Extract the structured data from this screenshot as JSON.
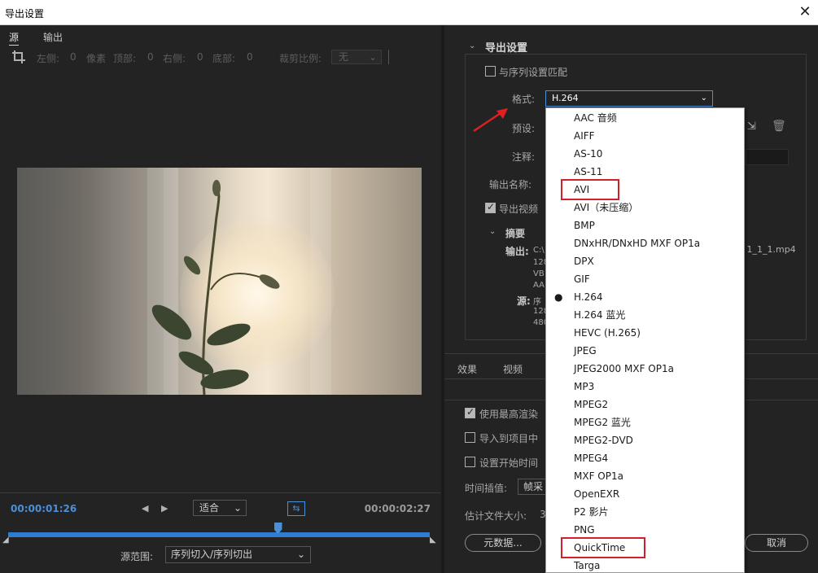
{
  "window": {
    "title": "导出设置",
    "close": "✕"
  },
  "left": {
    "tabs": [
      {
        "label": "源"
      },
      {
        "label": "输出"
      }
    ],
    "crop": {
      "left_label": "左侧:",
      "left_val": "0",
      "px_label": "像素",
      "top_label": "顶部:",
      "top_val": "0",
      "right_label": "右侧:",
      "right_val": "0",
      "bottom_label": "底部:",
      "bottom_val": "0",
      "ratio_label": "裁剪比例:",
      "ratio_val": "无"
    },
    "timeline": {
      "current": "00:00:01:26",
      "duration": "00:00:02:27",
      "fit": "适合",
      "range_label": "源范围:",
      "range_value": "序列切入/序列切出",
      "playhead_fraction": 0.64
    }
  },
  "right": {
    "section_title": "导出设置",
    "match_sequence": "与序列设置匹配",
    "format_label": "格式:",
    "format_value": "H.264",
    "preset_label": "预设:",
    "comment_label": "注释:",
    "output_name_label": "输出名称:",
    "export_video": "导出视频",
    "summary_label": "摘要",
    "summary_output": "输出:",
    "summary_output_lines": [
      "C:\\",
      "128",
      "VB",
      "AA"
    ],
    "summary_source": "源:",
    "summary_source_lines": [
      "序",
      "128",
      "480"
    ],
    "filename_tail": " 1_1_1.mp4",
    "tabs": [
      {
        "label": "效果"
      },
      {
        "label": "视频"
      }
    ],
    "max_render": "使用最高渲染",
    "import_project": "导入到项目中",
    "set_start_tc": "设置开始时间",
    "interp_label": "时间插值:",
    "interp_value": "帧采",
    "est_size_label": "估计文件大小:",
    "est_size_value": "3",
    "metadata_btn": "元数据...",
    "cancel_btn": "取消"
  },
  "format_options": [
    "AAC 音频",
    "AIFF",
    "AS-10",
    "AS-11",
    "AVI",
    "AVI（未压缩）",
    "BMP",
    "DNxHR/DNxHD MXF OP1a",
    "DPX",
    "GIF",
    "H.264",
    "H.264 蓝光",
    "HEVC (H.265)",
    "JPEG",
    "JPEG2000 MXF OP1a",
    "MP3",
    "MPEG2",
    "MPEG2 蓝光",
    "MPEG2-DVD",
    "MPEG4",
    "MXF OP1a",
    "OpenEXR",
    "P2 影片",
    "PNG",
    "QuickTime",
    "Targa"
  ],
  "selected_format_index": 10,
  "highlighted_options": [
    "AVI",
    "QuickTime"
  ],
  "colors": {
    "accent": "#4a90d9",
    "highlight": "#d0202a",
    "arrow": "#e02020"
  }
}
